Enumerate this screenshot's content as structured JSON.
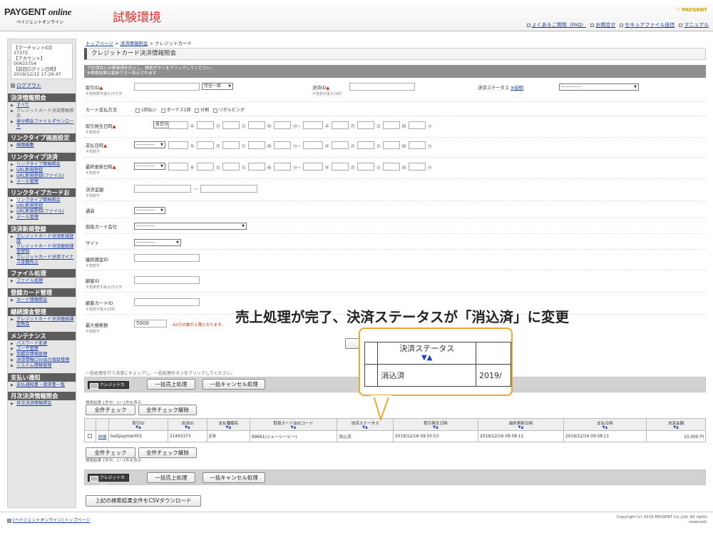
{
  "header": {
    "logo_main": "PAYGENT",
    "logo_italic": "online",
    "logo_sub": "ペイジェントオンライン",
    "env_label": "試験環境",
    "brand": "⁘ PAYGENT",
    "links": [
      "よくあるご質問（FAQ）",
      "お問合せ",
      "セキュアファイル送信",
      "マニュアル"
    ]
  },
  "sidebar": {
    "merchant_id_label": "【マーチャントID】",
    "merchant_id": "37372",
    "account_label": "【アカウント】",
    "account": "00433754",
    "last_login_label": "【前回ログイン日時】",
    "last_login": "2019/12/12 17:26:47",
    "logout": "ログアウト",
    "sections": [
      {
        "title": "決済情報照会",
        "items": [
          "すべて",
          "クレジットカード決済情報照会",
          "差分照会ファイルダウンロード"
        ]
      },
      {
        "title": "リンクタイプ画面設定",
        "items": [
          "画面編集"
        ]
      },
      {
        "title": "リンクタイプ決済",
        "items": [
          "リンクタイプ情報照会",
          "URL新規登録",
          "URL新規登録(ファイル)",
          "メール管理"
        ]
      },
      {
        "title": "リンクタイプカードお預かり",
        "items": [
          "リンクタイプ情報照会",
          "URL新規登録",
          "URL新規登録(ファイル)",
          "メール管理"
        ]
      },
      {
        "title": "決済新規登録",
        "items": [
          "クレジットカード決済新規登録",
          "クレジットカード決済継続課金登録",
          "クレジットカード決済マイナス金額売上"
        ]
      },
      {
        "title": "ファイル処理",
        "items": [
          "ファイル処理"
        ]
      },
      {
        "title": "登録カード管理",
        "items": [
          "カード情報照会"
        ]
      },
      {
        "title": "継続課金管理",
        "items": [
          "クレジットカード決済継続課金照会"
        ]
      },
      {
        "title": "メンテナンス",
        "items": [
          "パスワード変更",
          "ユーザ管理",
          "加盟店情報管理",
          "決済情報CSV出力項目管理",
          "システム情報管理"
        ]
      },
      {
        "title": "支払い通知",
        "items": [
          "支払通知書・請求書一覧"
        ]
      },
      {
        "title": "月次決済情報照会",
        "items": [
          "月次決済情報照会"
        ]
      }
    ]
  },
  "breadcrumb": {
    "home": "トップページ",
    "mid": "決済情報照会",
    "current": "クレジットカード",
    "sep": ">"
  },
  "page_title": "クレジットカード決済情報照会",
  "notice": {
    "line1": "下記項目に必要事項を記入し、検索ボタンをクリックしてください。",
    "line2": "※検索結果は最新下方へ表示されます"
  },
  "form": {
    "txn_id_label": "取引ID",
    "txn_id_note": "半角英数字最大25文字",
    "match_mode": "完全一致",
    "pay_id_label": "決済ID",
    "pay_id_note": "半角数字最大18桁",
    "status_label": "決済ステータス",
    "status_help": "※説明",
    "status_value": "-------------",
    "pay_method_label": "カード支払方法",
    "pay_methods": [
      "1回払い",
      "ボーナス1回",
      "分割",
      "リボルビング"
    ],
    "txn_date_label": "取引発生日時",
    "txn_date_mode": "本日分",
    "num_note": "半角数字",
    "paid_date_label": "支払日時",
    "paid_date_mode": "------------",
    "upd_date_label": "最終更新日時",
    "upd_date_mode": "------------",
    "units": {
      "year": "年",
      "month": "月",
      "day": "日",
      "hour": "時",
      "minute": "分",
      "tilde": "分～"
    },
    "amount_label": "決済金額",
    "amount_note": "半角数字",
    "range": "～",
    "currency_label": "通貨",
    "currency_value": "------------",
    "card_co_label": "取扱カード会社",
    "card_co_value": "------------",
    "site_label": "サイト",
    "site_value": "------------",
    "cont_id_label": "継続課金ID",
    "cont_id_note": "半角数字",
    "cust_id_label": "顧客ID",
    "cust_id_note": "半角英数字最大25文字",
    "cust_card_label": "顧客カードID",
    "cust_card_note": "半角数字最大18桁",
    "max_label": "最大検索数",
    "max_note": "半角数字",
    "max_value": "5000",
    "max_warn": "※5万の数が上限となります。"
  },
  "batch": {
    "instruction": "一括処理を行う決済にチェックし、一括処理ボタンをクリックしてください。",
    "card_label": "クレジットカード",
    "sales_btn": "一括売上処理",
    "cancel_btn": "一括キャンセル処理"
  },
  "results": {
    "summary": "検索結果 1件中、1〜1件を表示",
    "check_all": "全件チェック",
    "uncheck_all": "全件チェック解除",
    "arrows": "▼▲",
    "columns": [
      "取引ID",
      "決済ID",
      "支払種類名",
      "取扱カード会社コード",
      "決済ステータス",
      "取引発生日時",
      "最終更新日時",
      "支払日時",
      "決済金額"
    ],
    "rows": [
      {
        "detail": "詳細",
        "txn_id": "testpayment01",
        "pay_id": "21493373",
        "brand": "JCB",
        "card_co": "99661(ジェーシービー)",
        "status": "消込済",
        "created": "2019/12/16 09:55:53",
        "updated": "2019/12/16 09:58:11",
        "paid": "2019/12/16 09:58:11",
        "amount": "10,000 円"
      }
    ]
  },
  "csv_btn": "上記の検索結果全件をCSVダウンロード",
  "annotation": {
    "caption": "売上処理が完了、決済ステータスが「消込済」に変更",
    "col_header": "決済ステータス",
    "arrows": "▼▲",
    "value": "消込済",
    "clip_date": "2019/"
  },
  "footer": {
    "copyright": "Copyright (c) 2019 PAYGENT Co.,Ltd. All rights reserved.",
    "home_link": "[ペイジェントオンライン] トップページ"
  },
  "colors": {
    "header_accent": "#e03030",
    "callout_border": "#f0a830",
    "link": "#1a3d9e",
    "sort_arrow": "#1740c9"
  }
}
